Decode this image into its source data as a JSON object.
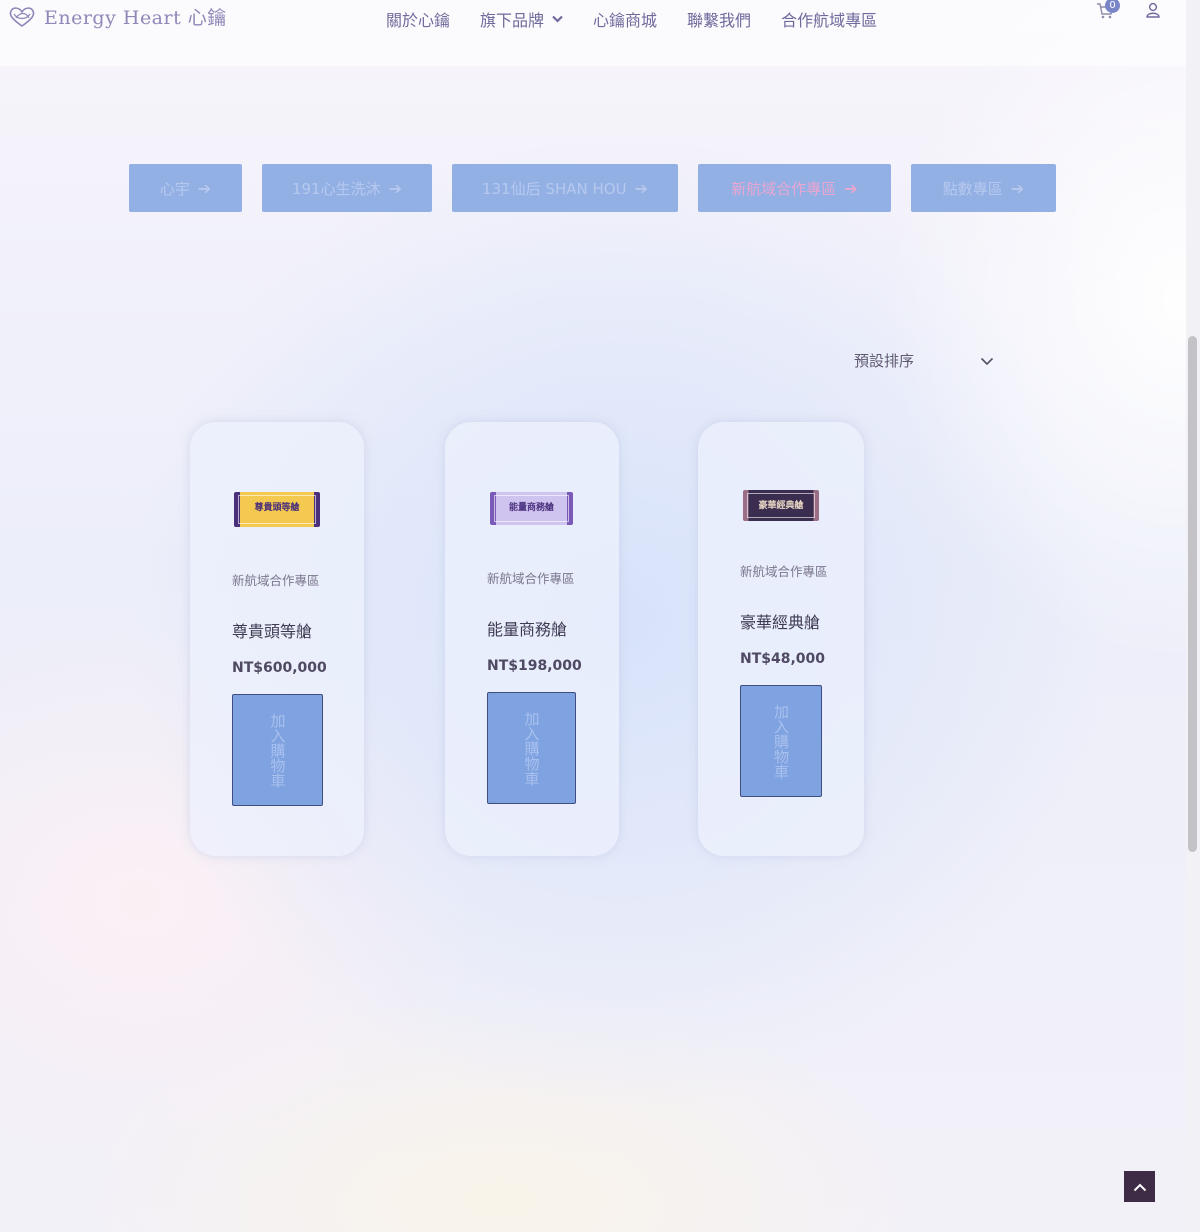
{
  "brand": {
    "name": "Energy Heart 心鑰"
  },
  "nav": {
    "items": [
      {
        "label": "關於心鑰",
        "has_dropdown": false
      },
      {
        "label": "旗下品牌",
        "has_dropdown": true
      },
      {
        "label": "心鑰商城",
        "has_dropdown": false
      },
      {
        "label": "聯繫我們",
        "has_dropdown": false
      },
      {
        "label": "合作航域專區",
        "has_dropdown": false
      }
    ],
    "cart_count": "0"
  },
  "categories": [
    {
      "label": "心宇",
      "color": "#b6c8ee"
    },
    {
      "label": "191心生洗沐",
      "color": "#b6c8ee"
    },
    {
      "label": "131仙后 SHAN HOU",
      "color": "#b6c8ee"
    },
    {
      "label": "新航域合作專區",
      "color": "#e9a6d1"
    },
    {
      "label": "點數專區",
      "color": "#b6c8ee"
    }
  ],
  "sort": {
    "selected": "預設排序"
  },
  "products": [
    {
      "category": "新航域合作專區",
      "name": "尊貴頭等艙",
      "price": "NT$600,000",
      "add_label": "加入購物車",
      "ticket_text": "尊貴頭等艙",
      "ticket_bg": "#f3c94f",
      "ticket_band": "#4a2f7a",
      "ticket_text_color": "#4a2f7a"
    },
    {
      "category": "新航域合作專區",
      "name": "能量商務艙",
      "price": "NT$198,000",
      "add_label": "加入購物車",
      "ticket_text": "能量商務艙",
      "ticket_bg": "#cfc3ef",
      "ticket_band": "#7a5ab8",
      "ticket_text_color": "#4b3380"
    },
    {
      "category": "新航域合作專區",
      "name": "豪華經典艙",
      "price": "NT$48,000",
      "add_label": "加入購物車",
      "ticket_text": "豪華經典艙",
      "ticket_bg": "#3b2d4f",
      "ticket_band": "#9a6f86",
      "ticket_text_color": "#e7d6c4"
    }
  ],
  "colors": {
    "accent_button": "#93b0e4",
    "add_button": "#7fa3e0",
    "back_to_top": "#3e2b45"
  }
}
